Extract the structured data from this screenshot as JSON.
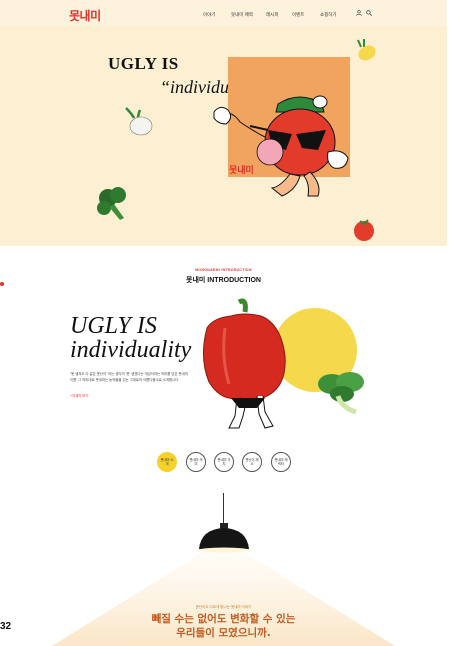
{
  "header": {
    "logo": "못내미",
    "nav": [
      "이야기",
      "못내미 매력",
      "레시피",
      "이벤트",
      "쇼핑하기"
    ],
    "login_icon": "user-icon",
    "search_icon": "search-icon"
  },
  "hero": {
    "headline": "UGLY IS",
    "tagline": "“individuality”",
    "badge_logo": "못내미"
  },
  "intro": {
    "kicker": "MONGNAEMI INTRODUCTION",
    "title": "못내미 INTRODUCTION",
    "headline_1": "UGLY IS",
    "headline_2": "individuality",
    "body": "“못 생겨도 다 같은 못난이” 라는 생각의 ‘못’ 생겼다는 개성이라는 의미를 담은 못내미 이름. 그 의미대로 못내미는 농작물을 있는 그대로의 아름다움으로 소개합니다.",
    "more_link": "+자세히 보기",
    "circles": [
      {
        "label": "못내미 소개",
        "active": true
      },
      {
        "label": "못내미 의미",
        "active": false
      },
      {
        "label": "못내미 가치",
        "active": false
      },
      {
        "label": "못난이 채소",
        "active": false
      },
      {
        "label": "못내미 캐릭터",
        "active": false
      }
    ]
  },
  "lamp": {
    "subtitle": "못난이도 다르게 빛나는 못내미 이야기",
    "title_line1": "빼질 수는 없어도 변화할 수 있는",
    "title_line2": "우리들이 모였으니까."
  },
  "page_number": "32",
  "colors": {
    "brand_red": "#e0312a",
    "hero_bg": "#fdf0d2",
    "accent_yellow": "#f5d84c",
    "accent_orange": "#f1a45e"
  }
}
